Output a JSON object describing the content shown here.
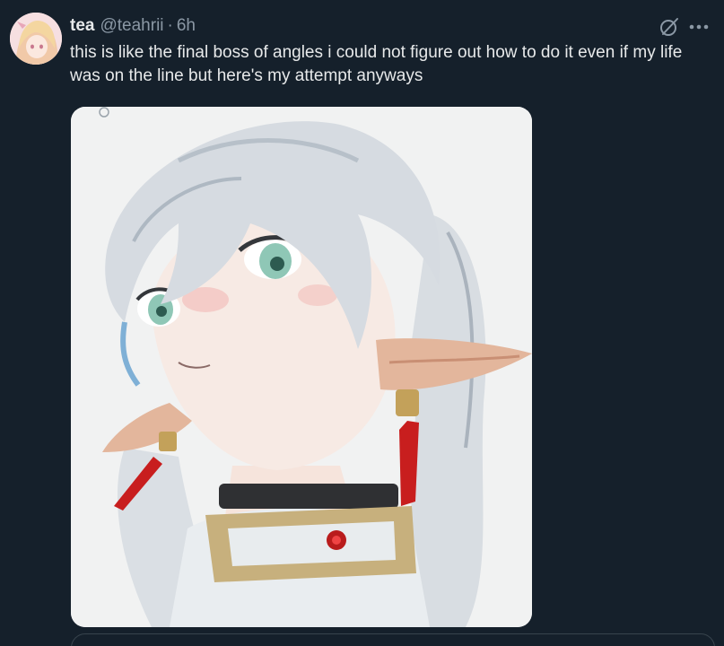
{
  "tweet": {
    "display_name": "tea",
    "handle": "@teahrii",
    "separator": "·",
    "time": "6h",
    "text": "this is like the final boss of angles i could not figure out how to do it even if my life was on the line but here's my attempt anyways",
    "icons": {
      "grok": "grok-icon",
      "more": "more-options-icon"
    }
  },
  "colors": {
    "background": "#15202b",
    "primary_text": "#e7e9ea",
    "secondary_text": "#8b98a5",
    "border": "#38444d"
  }
}
